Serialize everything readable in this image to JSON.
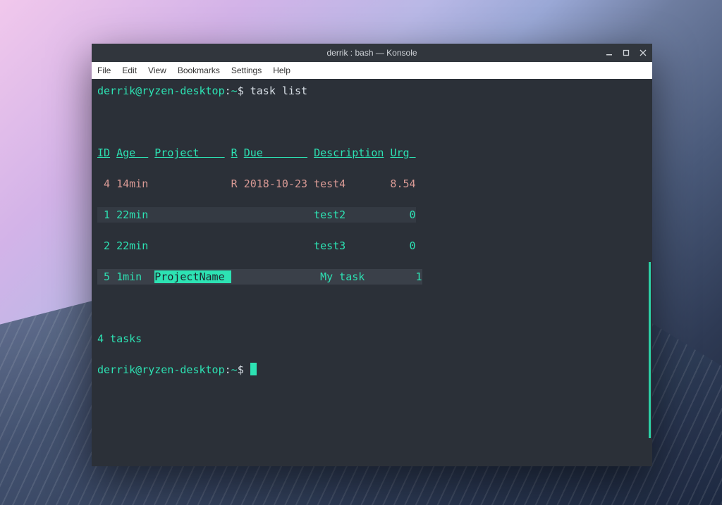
{
  "window": {
    "title": "derrik : bash — Konsole"
  },
  "menubar": {
    "file": "File",
    "edit": "Edit",
    "view": "View",
    "bookmarks": "Bookmarks",
    "settings": "Settings",
    "help": "Help"
  },
  "prompt": {
    "user_host": "derrik@ryzen-desktop",
    "separator": ":",
    "path": "~",
    "symbol": "$"
  },
  "command": "task list",
  "headers": {
    "id": "ID",
    "age": "Age  ",
    "project": "Project    ",
    "r": "R",
    "due": "Due       ",
    "description": "Description",
    "urg": "Urg "
  },
  "rows": [
    {
      "id": "4",
      "age": "14min",
      "project": "",
      "r": "R",
      "due": "2018-10-23",
      "description": "test4",
      "urg": "8.54",
      "style": "red"
    },
    {
      "id": "1",
      "age": "22min",
      "project": "",
      "r": "",
      "due": "",
      "description": "test2",
      "urg": "0",
      "style": "dark"
    },
    {
      "id": "2",
      "age": "22min",
      "project": "",
      "r": "",
      "due": "",
      "description": "test3",
      "urg": "0",
      "style": "plain"
    },
    {
      "id": "5",
      "age": "1min",
      "project": "ProjectName",
      "r": "",
      "due": "",
      "description": "My task",
      "urg": "1",
      "style": "dark2"
    }
  ],
  "summary": "4 tasks",
  "colors": {
    "accent": "#2de2b3",
    "terminal_bg": "#2b3038",
    "red": "#d99a95"
  }
}
